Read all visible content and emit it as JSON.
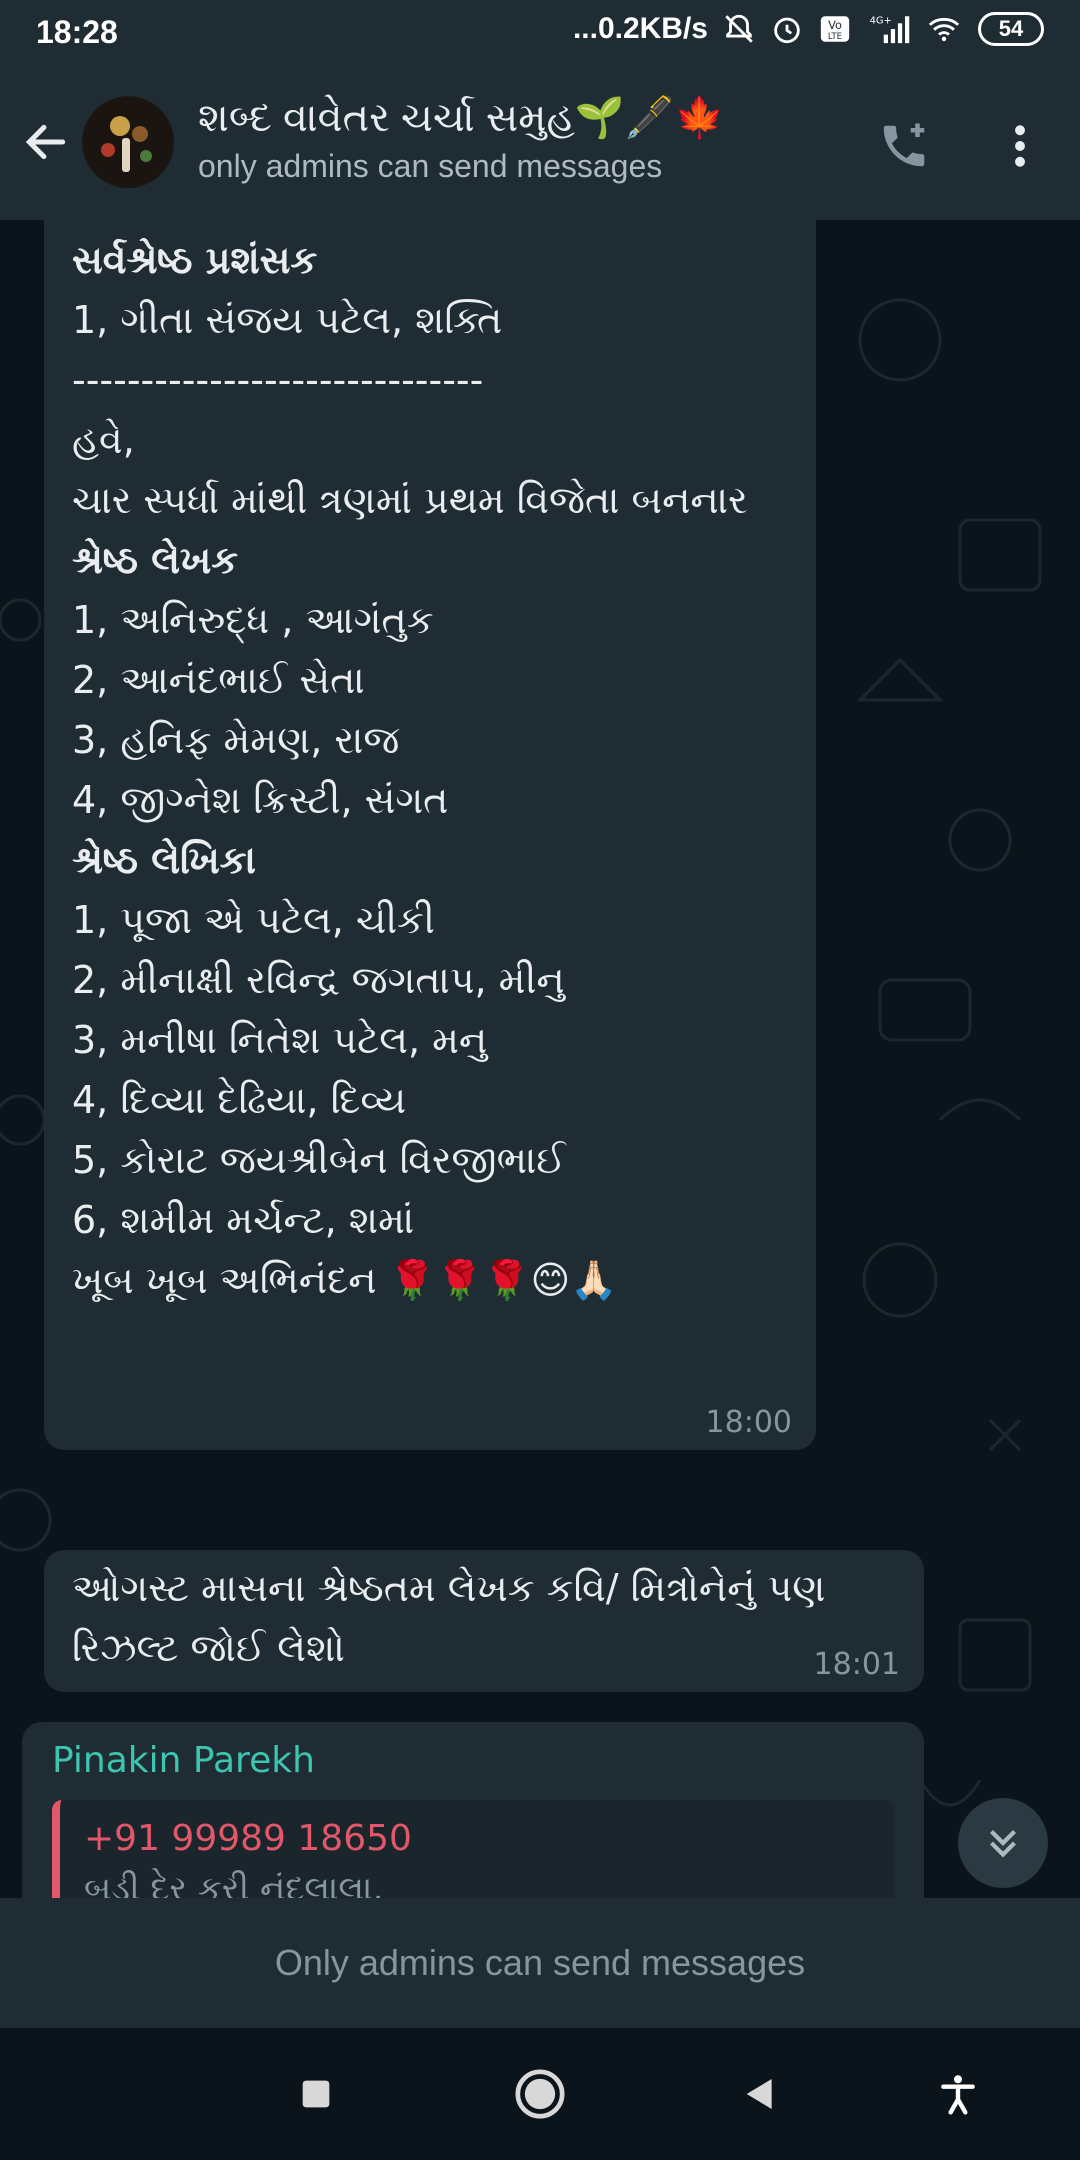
{
  "status_bar": {
    "time": "18:28",
    "network_speed": "...0.2KB/s",
    "network_type": "4G+",
    "battery": "54",
    "icons": [
      "mute-icon",
      "alarm-icon",
      "volte-icon",
      "signal-icon",
      "wifi-icon",
      "battery-icon"
    ]
  },
  "header": {
    "title": "શબ્દ વાવેતર ચર્ચા સમુહ🌱🖋️🍁",
    "subtitle": "only admins can send messages",
    "icons": [
      "back-arrow-icon",
      "add-call-icon",
      "more-vert-icon"
    ]
  },
  "messages": [
    {
      "lines": [
        {
          "text": "સર્વશ્રેષ્ઠ પ્રશંસક",
          "bold": true,
          "clipped": true
        },
        {
          "text": "1, ગીતા સંજય પટેલ, શક્તિ"
        },
        {
          "text": "------------------------------"
        },
        {
          "text": "હવે,"
        },
        {
          "text": " ચાર સ્પર્ધા માંથી ત્રણમાં પ્રથમ વિજેતા બનનાર"
        },
        {
          "text": ""
        },
        {
          "text": "શ્રેષ્ઠ લેખક",
          "bold": true
        },
        {
          "text": ""
        },
        {
          "text": "1,  અનિરુદ્ધ , આગંતુક"
        },
        {
          "text": "2, આનંદભાઈ સેતા"
        },
        {
          "text": "3, હનિફ મેમણ, રાજ"
        },
        {
          "text": "4, જીગ્નેશ ક્રિસ્ટી, સંગત"
        },
        {
          "text": ""
        },
        {
          "text": "શ્રેષ્ઠ લેખિકા",
          "bold": true
        },
        {
          "text": "1, પૂજા એ પટેલ, ચીકી"
        },
        {
          "text": "2, મીનાક્ષી રવિન્દ્ર જગતાપ, મીનુ"
        },
        {
          "text": "3, મનીષા નિતેશ પટેલ, મનુ"
        },
        {
          "text": "4, દિવ્યા દેઢિયા, દિવ્ય"
        },
        {
          "text": "5, કોરાટ જયશ્રીબેન વિરજીભાઈ"
        },
        {
          "text": "6, શમીમ મર્ચન્ટ, શમાં"
        },
        {
          "text": ""
        },
        {
          "text": "ખૂબ ખૂબ અભિનંદન 🌹🌹🌹😊🙏🏻"
        }
      ],
      "time": "18:00"
    },
    {
      "text": "ઓગસ્ટ માસના શ્રેષ્ઠતમ લેખક કવિ/ મિત્રોનેનું પણ રિઝલ્ટ જોઈ લેશો",
      "time": "18:01"
    },
    {
      "sender": "Pinakin Parekh",
      "quote_phone": "+91 99989 18650",
      "quote_text": "બડી દેર કરી નંદલાલા,"
    }
  ],
  "colors": {
    "background": "#0b141a",
    "bar": "#1f2c34",
    "bubble": "#202c33",
    "sender": "#3ec5b1",
    "quote_accent": "#e2576a"
  },
  "footer": {
    "admin_notice": "Only admins can send messages"
  },
  "nav": {
    "icons": [
      "recent-apps-icon",
      "home-icon",
      "back-icon",
      "accessibility-icon"
    ]
  }
}
